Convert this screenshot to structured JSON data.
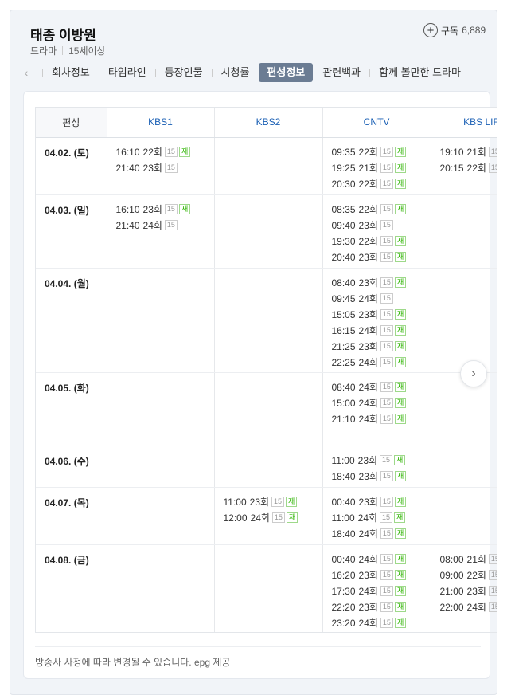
{
  "header": {
    "title": "태종 이방원",
    "genre": "드라마",
    "rating": "15세이상",
    "subscribe_label": "구독",
    "subscribe_count": "6,889"
  },
  "tabs": [
    {
      "label": "회차정보",
      "active": false
    },
    {
      "label": "타임라인",
      "active": false
    },
    {
      "label": "등장인물",
      "active": false
    },
    {
      "label": "시청률",
      "active": false
    },
    {
      "label": "편성정보",
      "active": true
    },
    {
      "label": "관련백과",
      "active": false
    },
    {
      "label": "함께 볼만한 드라마",
      "active": false
    }
  ],
  "table": {
    "date_header": "편성",
    "channels": [
      "KBS1",
      "KBS2",
      "CNTV",
      "KBS LIFE"
    ],
    "rows": [
      {
        "date": "04.02. (토)",
        "cells": [
          [
            {
              "t": "16:10",
              "ep": "22회",
              "r": true
            },
            {
              "t": "21:40",
              "ep": "23회",
              "r": false
            }
          ],
          [],
          [
            {
              "t": "09:35",
              "ep": "22회",
              "r": true
            },
            {
              "t": "19:25",
              "ep": "21회",
              "r": true
            },
            {
              "t": "20:30",
              "ep": "22회",
              "r": true
            }
          ],
          [
            {
              "t": "19:10",
              "ep": "21회",
              "r": false
            },
            {
              "t": "20:15",
              "ep": "22회",
              "r": false
            }
          ]
        ]
      },
      {
        "date": "04.03. (일)",
        "cells": [
          [
            {
              "t": "16:10",
              "ep": "23회",
              "r": true
            },
            {
              "t": "21:40",
              "ep": "24회",
              "r": false
            }
          ],
          [],
          [
            {
              "t": "08:35",
              "ep": "22회",
              "r": true
            },
            {
              "t": "09:40",
              "ep": "23회",
              "r": false
            },
            {
              "t": "19:30",
              "ep": "22회",
              "r": true
            },
            {
              "t": "20:40",
              "ep": "23회",
              "r": true
            }
          ],
          []
        ]
      },
      {
        "date": "04.04. (월)",
        "cells": [
          [],
          [],
          [
            {
              "t": "08:40",
              "ep": "23회",
              "r": true
            },
            {
              "t": "09:45",
              "ep": "24회",
              "r": false
            },
            {
              "t": "15:05",
              "ep": "23회",
              "r": true
            },
            {
              "t": "16:15",
              "ep": "24회",
              "r": true
            },
            {
              "t": "21:25",
              "ep": "23회",
              "r": true
            },
            {
              "t": "22:25",
              "ep": "24회",
              "r": true
            }
          ],
          []
        ]
      },
      {
        "date": "04.05. (화)",
        "cells": [
          [],
          [],
          [
            {
              "t": "08:40",
              "ep": "24회",
              "r": true
            },
            {
              "t": "15:00",
              "ep": "24회",
              "r": true
            },
            {
              "t": "21:10",
              "ep": "24회",
              "r": true
            }
          ],
          []
        ]
      },
      {
        "date": "04.06. (수)",
        "cells": [
          [],
          [],
          [
            {
              "t": "11:00",
              "ep": "23회",
              "r": true
            },
            {
              "t": "18:40",
              "ep": "23회",
              "r": true
            }
          ],
          []
        ]
      },
      {
        "date": "04.07. (목)",
        "cells": [
          [],
          [
            {
              "t": "11:00",
              "ep": "23회",
              "r": true
            },
            {
              "t": "12:00",
              "ep": "24회",
              "r": true
            }
          ],
          [
            {
              "t": "00:40",
              "ep": "23회",
              "r": true
            },
            {
              "t": "11:00",
              "ep": "24회",
              "r": true
            },
            {
              "t": "18:40",
              "ep": "24회",
              "r": true
            }
          ],
          []
        ]
      },
      {
        "date": "04.08. (금)",
        "cells": [
          [],
          [],
          [
            {
              "t": "00:40",
              "ep": "24회",
              "r": true
            },
            {
              "t": "16:20",
              "ep": "23회",
              "r": true
            },
            {
              "t": "17:30",
              "ep": "24회",
              "r": true
            },
            {
              "t": "22:20",
              "ep": "23회",
              "r": true
            },
            {
              "t": "23:20",
              "ep": "24회",
              "r": true
            }
          ],
          [
            {
              "t": "08:00",
              "ep": "21회",
              "r": false
            },
            {
              "t": "09:00",
              "ep": "22회",
              "r": false
            },
            {
              "t": "21:00",
              "ep": "23회",
              "r": false
            },
            {
              "t": "22:00",
              "ep": "24회",
              "r": false
            }
          ]
        ]
      }
    ]
  },
  "badges": {
    "age": "15",
    "rerun": "재"
  },
  "notice": "방송사 사정에 따라 변경될 수 있습니다. epg 제공",
  "icons": {
    "prev": "chevron-left-icon",
    "next": "chevron-right-icon",
    "subscribe": "plus-circle-icon"
  }
}
